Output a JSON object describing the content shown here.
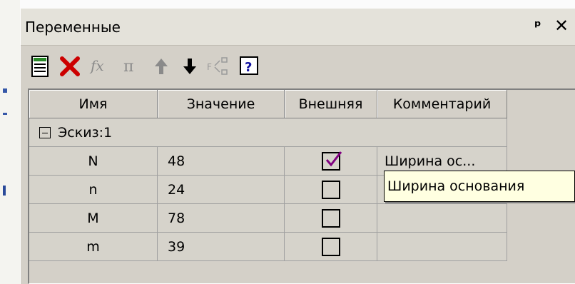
{
  "panel": {
    "title": "Переменные",
    "pin_icon": "pin-icon",
    "close_icon": "close-icon"
  },
  "toolbar": {
    "buttons": [
      {
        "name": "variables-list",
        "icon": "table-icon",
        "enabled": true
      },
      {
        "name": "delete",
        "icon": "red-x-icon",
        "enabled": true
      },
      {
        "name": "function",
        "icon": "fx-icon",
        "enabled": false
      },
      {
        "name": "pi",
        "icon": "pi-icon",
        "enabled": false
      },
      {
        "name": "move-up",
        "icon": "arrow-up-icon",
        "enabled": false
      },
      {
        "name": "move-down",
        "icon": "arrow-down-icon",
        "enabled": true
      },
      {
        "name": "expand",
        "icon": "expand-icon",
        "enabled": false
      },
      {
        "name": "help",
        "icon": "help-icon",
        "enabled": true
      }
    ]
  },
  "table": {
    "columns": [
      "Имя",
      "Значение",
      "Внешняя",
      "Комментарий"
    ],
    "group": {
      "label": "Эскиз:1",
      "expanded": true
    },
    "rows": [
      {
        "name": "N",
        "value": "48",
        "external": true,
        "comment": "Ширина ос..."
      },
      {
        "name": "n",
        "value": "24",
        "external": false,
        "comment": ""
      },
      {
        "name": "M",
        "value": "78",
        "external": false,
        "comment": ""
      },
      {
        "name": "m",
        "value": "39",
        "external": false,
        "comment": ""
      }
    ]
  },
  "tooltip": {
    "text": "Ширина основания"
  },
  "colors": {
    "delete_icon": "#cc0000",
    "check": "#800080",
    "help_icon": "#1010a0",
    "tooltip_bg": "#ffffe1"
  }
}
